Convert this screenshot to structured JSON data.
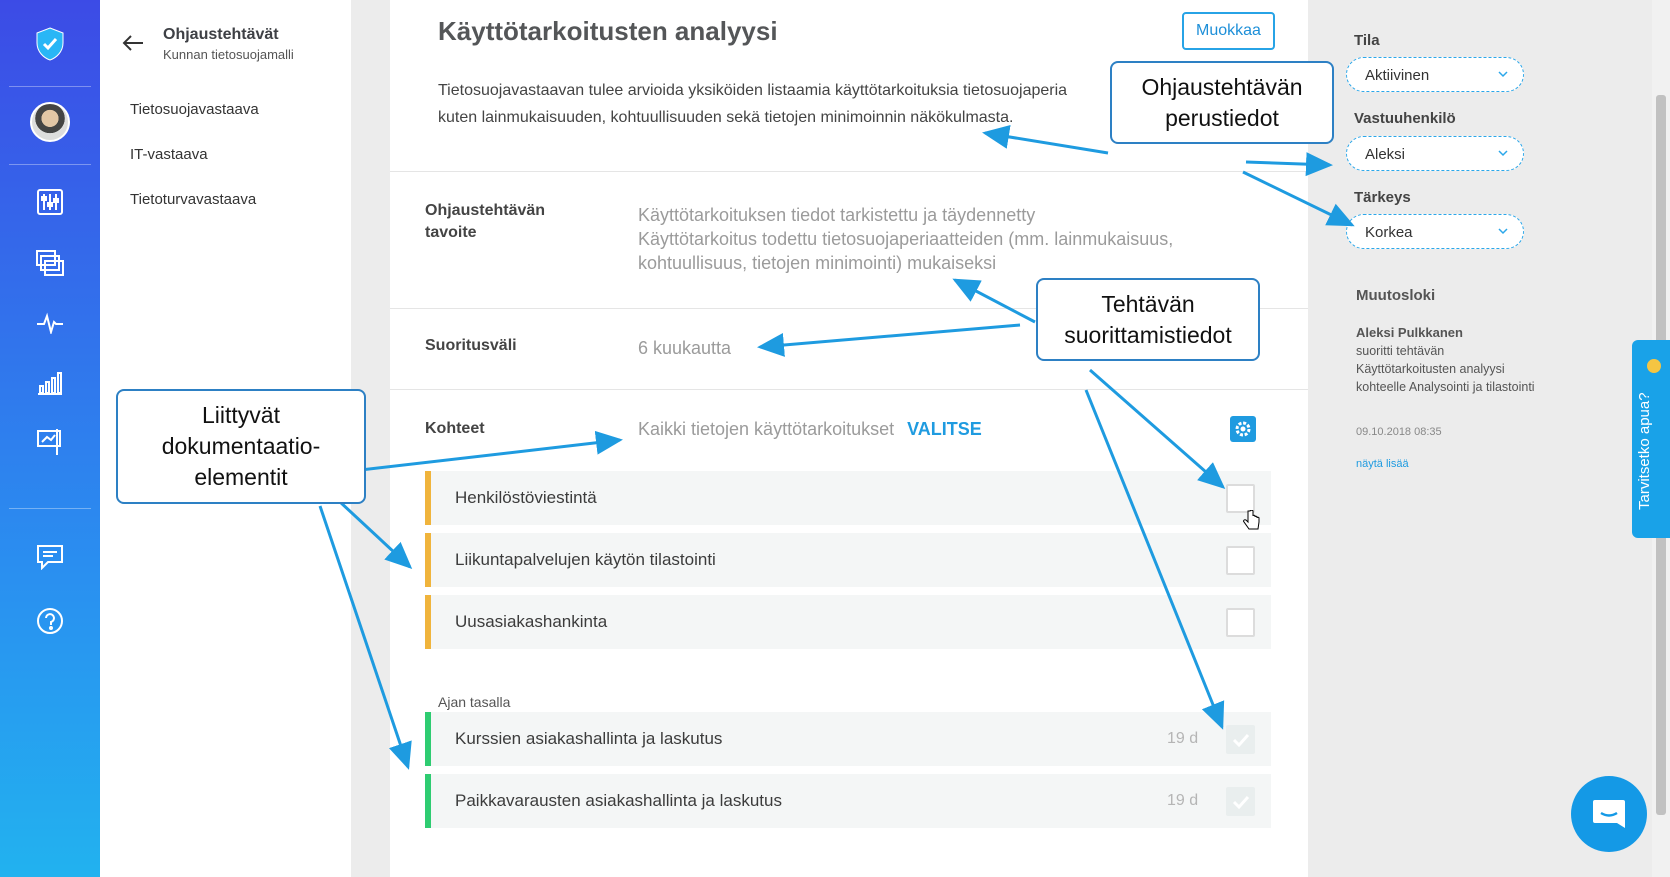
{
  "rail": {
    "icons": [
      "shield-logo",
      "avatar",
      "sliders-icon",
      "layers-icon",
      "pulse-icon",
      "bar-chart-icon",
      "presentation-icon",
      "chat-icon",
      "help-icon"
    ]
  },
  "subnav": {
    "title": "Ohjaustehtävät",
    "subtitle": "Kunnan tietosuojamalli",
    "items": [
      "Tietosuojavastaava",
      "IT-vastaava",
      "Tietoturvavastaava"
    ]
  },
  "main": {
    "title": "Käyttötarkoitusten analyysi",
    "edit_label": "Muokkaa",
    "intro_line1": "Tietosuojavastaavan tulee arvioida yksiköiden listaamia käyttötarkoituksia tietosuojaperia",
    "intro_line2": "kuten lainmukaisuuden, kohtuullisuuden sekä tietojen minimoinnin näkökulmasta.",
    "goal_label_1": "Ohjaustehtävän",
    "goal_label_2": "tavoite",
    "goal_line1": "Käyttötarkoituksen tiedot tarkistettu ja täydennetty",
    "goal_line2": "Käyttötarkoitus todettu tietosuojaperiaatteiden (mm. lainmukaisuus,",
    "goal_line3": "kohtuullisuus, tietojen minimointi) mukaiseksi",
    "interval_label": "Suoritusväli",
    "interval_value": "6 kuukautta",
    "targets_label": "Kohteet",
    "targets_value": "Kaikki tietojen käyttötarkoitukset",
    "targets_link": "VALITSE",
    "pending": [
      {
        "name": "Henkilöstöviestintä"
      },
      {
        "name": "Liikuntapalvelujen käytön tilastointi"
      },
      {
        "name": "Uusasiakashankinta"
      }
    ],
    "uptodate_label": "Ajan tasalla",
    "uptodate": [
      {
        "name": "Kurssien asiakashallinta ja laskutus",
        "days": "19 d"
      },
      {
        "name": "Paikkavarausten asiakashallinta ja laskutus",
        "days": "19 d"
      }
    ]
  },
  "side": {
    "status_label": "Tila",
    "status_value": "Aktiivinen",
    "owner_label": "Vastuuhenkilö",
    "owner_value": "Aleksi",
    "priority_label": "Tärkeys",
    "priority_value": "Korkea",
    "log_title": "Muutosloki",
    "log_user": "Aleksi Pulkkanen",
    "log_text": "suoritti tehtävän Käyttötarkoitusten analyysi kohteelle Analysointi ja tilastointi",
    "log_date": "09.10.2018 08:35",
    "log_more": "näytä lisää"
  },
  "help_tab": "Tarvitsetko apua?",
  "callouts": {
    "basic_1": "Ohjaustehtävän",
    "basic_2": "perustiedot",
    "exec_1": "Tehtävän",
    "exec_2": "suorittamistiedot",
    "docs_1": "Liittyvät",
    "docs_2": "dokumentaatio-",
    "docs_3": "elementit"
  },
  "colors": {
    "accent": "#1f9be0",
    "pending_bar": "#f0b43c",
    "done_bar": "#2ecc71",
    "callout_border": "#2d80c4",
    "arrow": "#1e9be0"
  }
}
